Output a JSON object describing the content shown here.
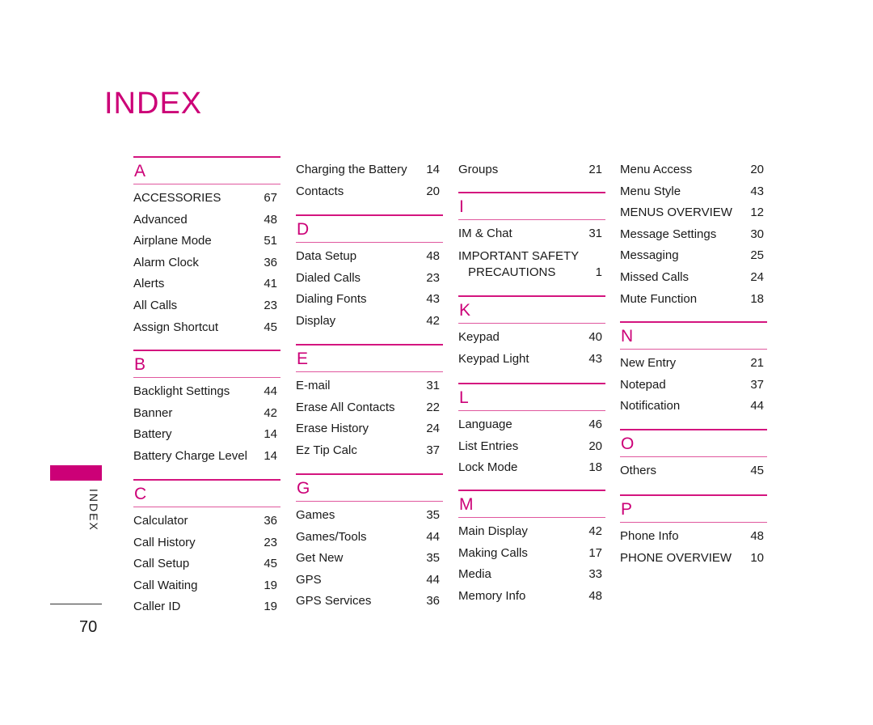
{
  "title": "INDEX",
  "side_label": "INDEX",
  "page_number": "70",
  "colors": {
    "accent": "#cc0077"
  },
  "columns": [
    {
      "sections": [
        {
          "letter": "A",
          "entries": [
            {
              "term": "ACCESSORIES",
              "page": "67"
            },
            {
              "term": "Advanced",
              "page": "48"
            },
            {
              "term": "Airplane Mode",
              "page": "51"
            },
            {
              "term": "Alarm Clock",
              "page": "36"
            },
            {
              "term": "Alerts",
              "page": "41"
            },
            {
              "term": "All Calls",
              "page": "23"
            },
            {
              "term": "Assign Shortcut",
              "page": "45"
            }
          ]
        },
        {
          "letter": "B",
          "entries": [
            {
              "term": "Backlight Settings",
              "page": "44"
            },
            {
              "term": "Banner",
              "page": "42"
            },
            {
              "term": "Battery",
              "page": "14"
            },
            {
              "term": "Battery Charge Level",
              "page": "14"
            }
          ]
        },
        {
          "letter": "C",
          "entries": [
            {
              "term": "Calculator",
              "page": "36"
            },
            {
              "term": "Call History",
              "page": "23"
            },
            {
              "term": "Call Setup",
              "page": "45"
            },
            {
              "term": "Call Waiting",
              "page": "19"
            },
            {
              "term": "Caller ID",
              "page": "19"
            }
          ]
        }
      ]
    },
    {
      "continued": [
        {
          "term": "Charging the Battery",
          "page": "14"
        },
        {
          "term": "Contacts",
          "page": "20"
        }
      ],
      "sections": [
        {
          "letter": "D",
          "entries": [
            {
              "term": "Data Setup",
              "page": "48"
            },
            {
              "term": "Dialed Calls",
              "page": "23"
            },
            {
              "term": "Dialing Fonts",
              "page": "43"
            },
            {
              "term": "Display",
              "page": "42"
            }
          ]
        },
        {
          "letter": "E",
          "entries": [
            {
              "term": "E-mail",
              "page": "31"
            },
            {
              "term": "Erase All Contacts",
              "page": "22"
            },
            {
              "term": "Erase History",
              "page": "24"
            },
            {
              "term": "Ez Tip Calc",
              "page": "37"
            }
          ]
        },
        {
          "letter": "G",
          "entries": [
            {
              "term": "Games",
              "page": "35"
            },
            {
              "term": "Games/Tools",
              "page": "44"
            },
            {
              "term": "Get New",
              "page": "35"
            },
            {
              "term": "GPS",
              "page": "44"
            },
            {
              "term": "GPS Services",
              "page": "36"
            }
          ]
        }
      ]
    },
    {
      "continued": [
        {
          "term": "Groups",
          "page": "21"
        }
      ],
      "sections": [
        {
          "letter": "I",
          "entries": [
            {
              "term": "IM & Chat",
              "page": "31"
            },
            {
              "term": "IMPORTANT SAFETY",
              "term2": "PRECAUTIONS",
              "page": "1"
            }
          ]
        },
        {
          "letter": "K",
          "entries": [
            {
              "term": "Keypad",
              "page": "40"
            },
            {
              "term": "Keypad Light",
              "page": "43"
            }
          ]
        },
        {
          "letter": "L",
          "entries": [
            {
              "term": "Language",
              "page": "46"
            },
            {
              "term": "List Entries",
              "page": "20"
            },
            {
              "term": "Lock Mode",
              "page": "18"
            }
          ]
        },
        {
          "letter": "M",
          "entries": [
            {
              "term": "Main Display",
              "page": "42"
            },
            {
              "term": "Making Calls",
              "page": "17"
            },
            {
              "term": "Media",
              "page": "33"
            },
            {
              "term": "Memory Info",
              "page": "48"
            }
          ]
        }
      ]
    },
    {
      "continued": [
        {
          "term": "Menu Access",
          "page": "20"
        },
        {
          "term": "Menu Style",
          "page": "43"
        },
        {
          "term": "MENUS OVERVIEW",
          "page": "12"
        },
        {
          "term": "Message Settings",
          "page": "30"
        },
        {
          "term": "Messaging",
          "page": "25"
        },
        {
          "term": "Missed Calls",
          "page": "24"
        },
        {
          "term": "Mute Function",
          "page": "18"
        }
      ],
      "sections": [
        {
          "letter": "N",
          "entries": [
            {
              "term": "New Entry",
              "page": "21"
            },
            {
              "term": "Notepad",
              "page": "37"
            },
            {
              "term": "Notification",
              "page": "44"
            }
          ]
        },
        {
          "letter": "O",
          "entries": [
            {
              "term": "Others",
              "page": "45"
            }
          ]
        },
        {
          "letter": "P",
          "entries": [
            {
              "term": "Phone Info",
              "page": "48"
            },
            {
              "term": "PHONE OVERVIEW",
              "page": "10"
            }
          ]
        }
      ]
    }
  ]
}
